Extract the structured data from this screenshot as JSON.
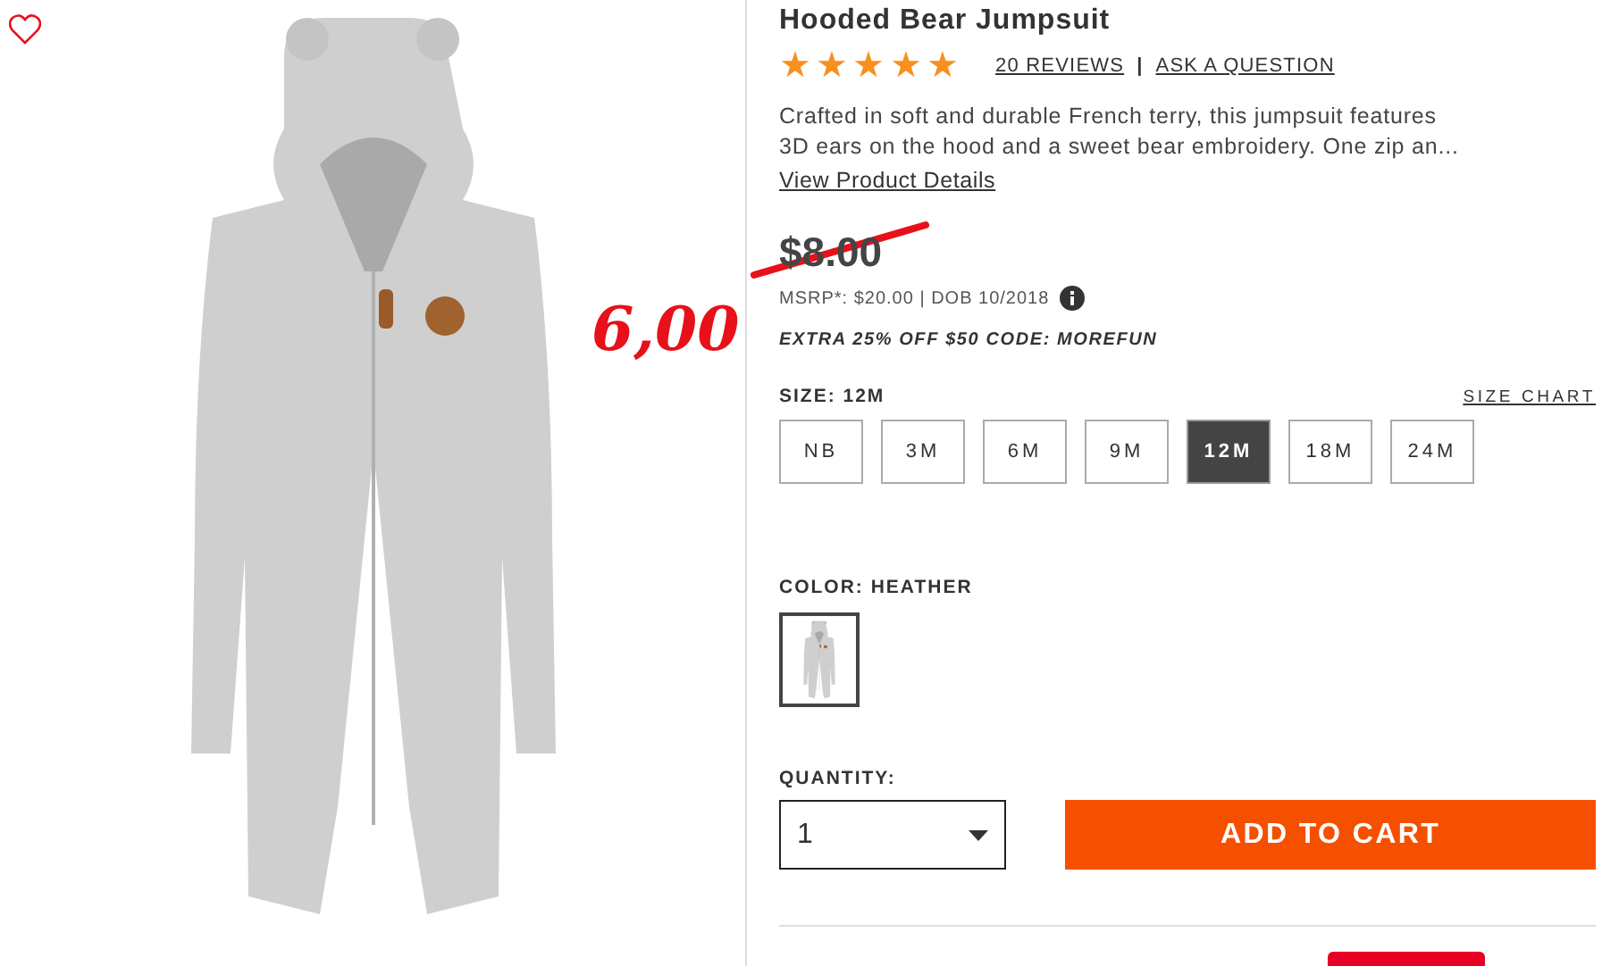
{
  "favorite": {
    "selected": false
  },
  "annotation": {
    "text": "6,00",
    "strikes_price": true
  },
  "product": {
    "title": "Hooded Bear Jumpsuit",
    "stars": 5,
    "reviews_link": "20 REVIEWS",
    "separator": "|",
    "ask_link": "ASK A QUESTION",
    "description": "Crafted in soft and durable French terry, this jumpsuit features 3D ears on the hood and a sweet bear embroidery. One zip an...",
    "details_link": "View Product Details",
    "price": "$8.00",
    "msrp": "MSRP*: $20.00 | DOB 10/2018",
    "promo": "EXTRA 25% OFF $50 CODE: MOREFUN"
  },
  "size": {
    "label": "SIZE: 12M",
    "chart_link": "SIZE CHART",
    "options": [
      {
        "label": "NB",
        "selected": false
      },
      {
        "label": "3M",
        "selected": false
      },
      {
        "label": "6M",
        "selected": false
      },
      {
        "label": "9M",
        "selected": false
      },
      {
        "label": "12M",
        "selected": true
      },
      {
        "label": "18M",
        "selected": false
      },
      {
        "label": "24M",
        "selected": false
      }
    ]
  },
  "color": {
    "label": "COLOR: HEATHER",
    "swatches": [
      {
        "selected": true
      }
    ]
  },
  "quantity": {
    "label": "QUANTITY:",
    "value": "1"
  },
  "add_to_cart": "ADD TO CART"
}
